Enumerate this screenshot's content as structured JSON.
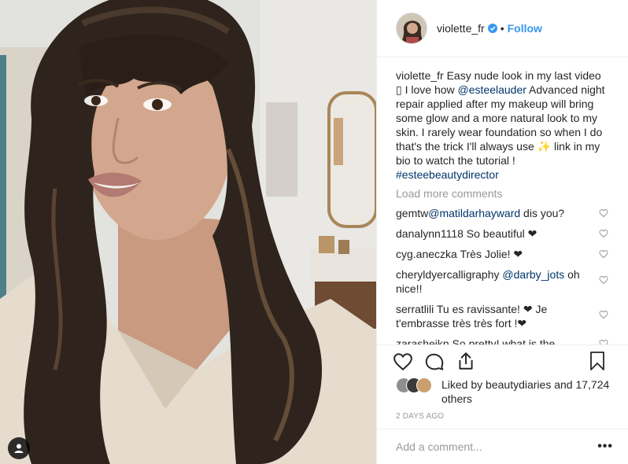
{
  "photo": {
    "alt_icon": "user-tag-icon"
  },
  "header": {
    "username": "violette_fr",
    "separator": "•",
    "follow_label": "Follow",
    "verified_icon": "verified-badge-icon"
  },
  "caption": {
    "username": "violette_fr",
    "text_1": " Easy nude look in my last video ▯ I love how ",
    "mention": "@esteelauder",
    "text_2": " Advanced night repair applied after my makeup will bring some glow and a more natural look to my skin. I rarely wear foundation so when I do that's the trick I'll always use ✨ link in my bio to watch the tutorial ! ",
    "hashtag": "#esteebeautydirector"
  },
  "load_more": "Load more comments",
  "comments": [
    {
      "user": "gemtw",
      "mention": "@matildarhayward",
      "text": " dis you?"
    },
    {
      "user": "danalynn1118",
      "mention": "",
      "text": " So beautiful ❤"
    },
    {
      "user": "cyg.aneczka",
      "mention": "",
      "text": " Très Jolie! ❤"
    },
    {
      "user": "cheryldyercalligraphy",
      "mention": "@darby_jots",
      "text": " oh nice!!"
    },
    {
      "user": "serratlili",
      "mention": "",
      "text": " Tu es ravissante! ❤ Je t'embrasse très très fort !❤"
    },
    {
      "user": "zarasheikn",
      "mention": "",
      "text": " So pretty! what is the"
    }
  ],
  "actions": {
    "like_icon": "heart-icon",
    "comment_icon": "comment-icon",
    "share_icon": "share-icon",
    "save_icon": "bookmark-icon"
  },
  "likes": {
    "prefix": "Liked by ",
    "user": "beautydiaries",
    "middle": " and ",
    "count": "17,724 others"
  },
  "timestamp": "2 DAYS AGO",
  "add_comment": {
    "placeholder": "Add a comment...",
    "more_label": "•••"
  },
  "colors": {
    "link": "#003569",
    "follow": "#3897f0",
    "muted": "#999999",
    "border": "#efefef"
  }
}
